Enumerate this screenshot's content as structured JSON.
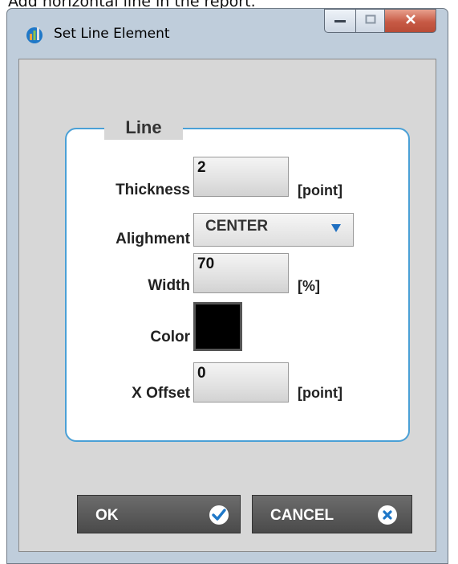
{
  "background_caption": "Add horizontal line in the report.",
  "window": {
    "title": "Set Line Element",
    "icon": "app-chart-icon",
    "controls": [
      "minimize-icon",
      "maximize-icon",
      "close-icon"
    ]
  },
  "group": {
    "title": "Line",
    "border_color": "#4aa0d6"
  },
  "fields": {
    "thickness": {
      "label": "Thickness",
      "value": "2",
      "unit": "[point]"
    },
    "alignment": {
      "label": "Alighment",
      "value": "CENTER",
      "icon": "dropdown-arrow-icon"
    },
    "width": {
      "label": "Width",
      "value": "70",
      "unit": "[%]"
    },
    "color": {
      "label": "Color",
      "value": "#000000"
    },
    "x_offset": {
      "label": "X Offset",
      "value": "0",
      "unit": "[point]"
    }
  },
  "buttons": {
    "ok": {
      "label": "OK",
      "icon": "checkmark-icon"
    },
    "cancel": {
      "label": "CANCEL",
      "icon": "cancel-x-icon"
    }
  }
}
